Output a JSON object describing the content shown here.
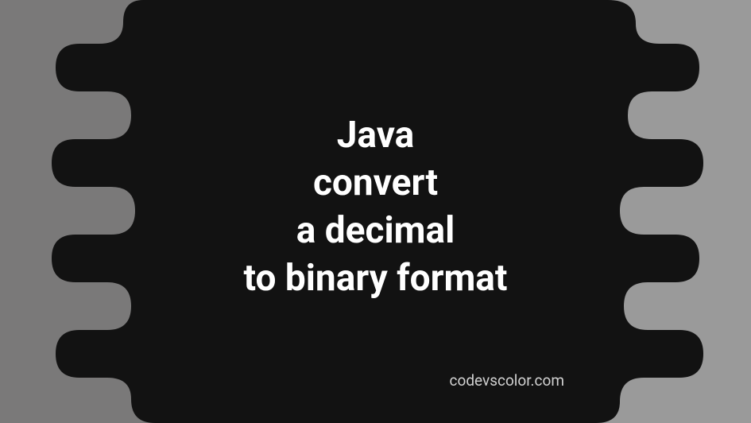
{
  "title_line1": "Java",
  "title_line2": "convert",
  "title_line3": "a decimal",
  "title_line4": "to binary format",
  "watermark": "codevscolor.com",
  "colors": {
    "bg_left": "#7a7979",
    "bg_right": "#9a9a9a",
    "blob": "#121212",
    "text": "#ffffff",
    "watermark": "#d0d0d0"
  }
}
